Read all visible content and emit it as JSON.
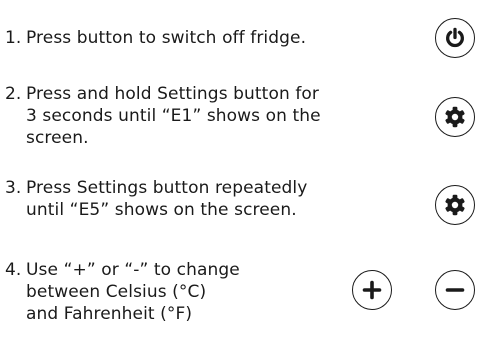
{
  "steps": [
    {
      "number": "1.",
      "lines": [
        "Press button to  switch off fridge."
      ],
      "icons": [
        "power-icon"
      ]
    },
    {
      "number": "2.",
      "lines": [
        "Press and hold Settings button for",
        "3 seconds until “E1” shows on the",
        "screen."
      ],
      "icons": [
        "settings-gear-icon"
      ]
    },
    {
      "number": "3.",
      "lines": [
        "Press Settings button repeatedly",
        "until “E5” shows on the screen."
      ],
      "icons": [
        "settings-gear-icon"
      ]
    },
    {
      "number": "4.",
      "lines": [
        "Use “+” or “-” to change",
        "between Celsius (°C)",
        "and Fahrenheit (°F)"
      ],
      "icons": [
        "plus-icon",
        "minus-icon"
      ]
    }
  ],
  "colors": {
    "text": "#1a1a1a",
    "icon": "#1a1a1a",
    "background": "#ffffff"
  }
}
